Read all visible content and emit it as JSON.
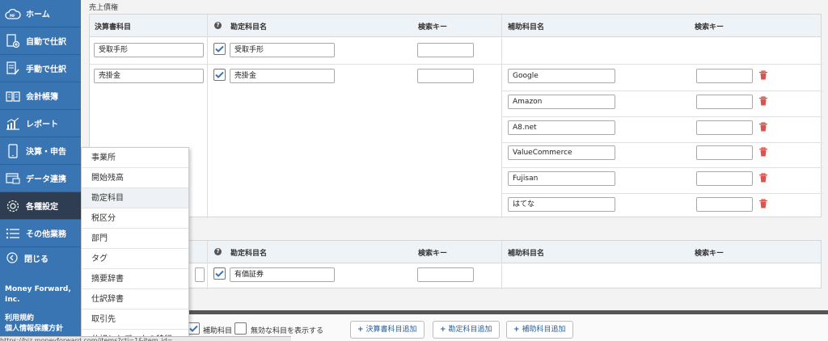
{
  "sidebar": {
    "items": [
      {
        "label": "ホーム",
        "icon": "cloud-mf-icon"
      },
      {
        "label": "自動で仕訳",
        "icon": "auto-journal-icon"
      },
      {
        "label": "手動で仕訳",
        "icon": "manual-journal-icon"
      },
      {
        "label": "会計帳簿",
        "icon": "book-icon"
      },
      {
        "label": "レポート",
        "icon": "report-chart-icon"
      },
      {
        "label": "決算・申告",
        "icon": "tablet-icon"
      },
      {
        "label": "データ連携",
        "icon": "data-link-icon"
      },
      {
        "label": "各種設定",
        "icon": "gear-icon"
      },
      {
        "label": "その他業務",
        "icon": "list-icon"
      }
    ],
    "close_label": "閉じる",
    "company": "Money Forward, Inc.",
    "terms": "利用規約",
    "privacy": "個人情報保護方針"
  },
  "flyout": {
    "items": [
      "事業所",
      "開始残高",
      "勘定科目",
      "税区分",
      "部門",
      "タグ",
      "摘要辞書",
      "仕訳辞書",
      "取引先",
      "仕訳したデータの移行"
    ]
  },
  "section1": {
    "title": "売上債権",
    "headers": {
      "settlement": "決算書科目",
      "account": "勘定科目名",
      "search": "検索キー",
      "sub": "補助科目名",
      "sub_search": "検索キー"
    },
    "rows": [
      {
        "settlement": "受取手形",
        "account": "受取手形",
        "search": ""
      },
      {
        "settlement": "売掛金",
        "account": "売掛金",
        "search": "",
        "subs": [
          "Google",
          "Amazon",
          "A8.net",
          "ValueCommerce",
          "Fujisan",
          "はてな"
        ]
      }
    ]
  },
  "section2": {
    "headers": {
      "account": "勘定科目名",
      "search": "検索キー",
      "sub": "補助科目名",
      "sub_search": "検索キー"
    },
    "row": {
      "account": "有価証券",
      "search": ""
    }
  },
  "bottom": {
    "sub_check_label": "補助科目",
    "invalid_label": "無効な科目を表示する",
    "add_settlement": "決算書科目追加",
    "add_account": "勘定科目追加",
    "add_sub": "補助科目追加",
    "plus": "+"
  },
  "status_url": "https://biz.moneyforward.com/items?cti=1&item_id=...",
  "colors": {
    "sidebar": "#3a75b3",
    "accent": "#2a5f9e",
    "trash": "#d9534f"
  }
}
